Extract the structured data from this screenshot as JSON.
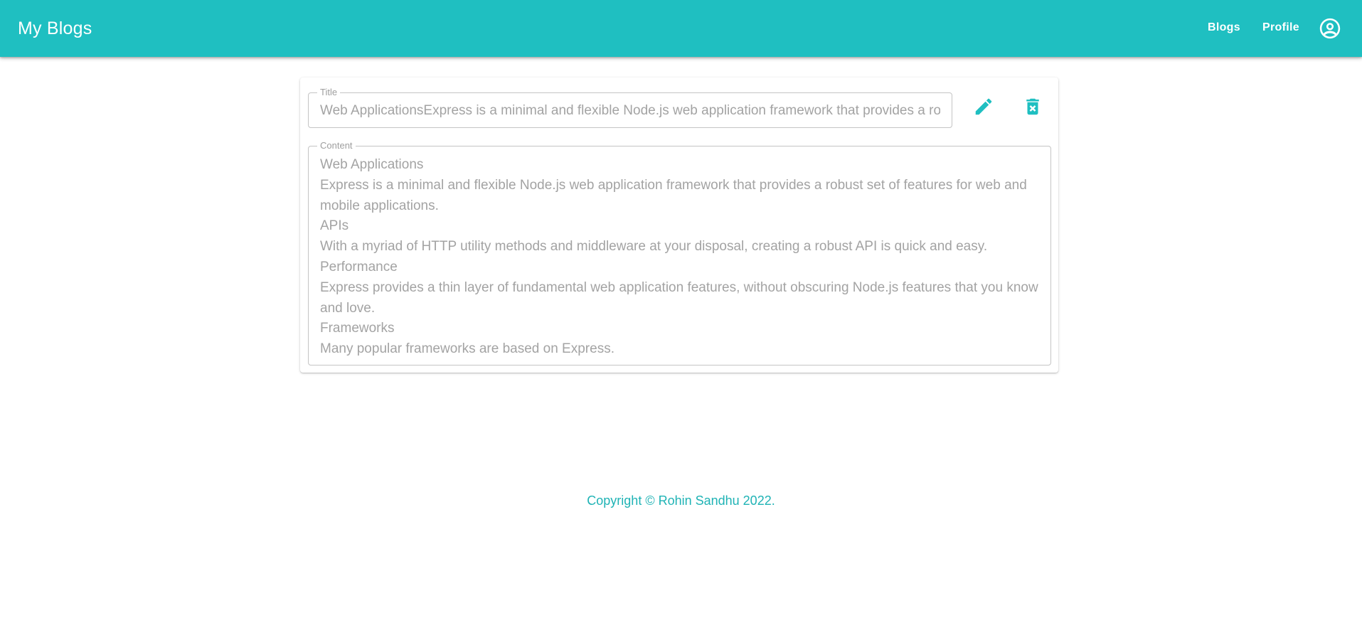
{
  "appbar": {
    "brand": "My Blogs",
    "nav": [
      {
        "label": "Blogs"
      },
      {
        "label": "Profile"
      }
    ],
    "account_icon": "account-circle-icon"
  },
  "blog": {
    "title_label": "Title",
    "title_value": "Web ApplicationsExpress is a minimal and flexible Node.js web application framework that provides a robust set of features for web and mobile applications.",
    "content_label": "Content",
    "content_lines": [
      "Web Applications",
      "Express is a minimal and flexible Node.js web application framework that provides a robust set of features for web and mobile applications.",
      "APIs",
      "With a myriad of HTTP utility methods and middleware at your disposal, creating a robust API is quick and easy.",
      "Performance",
      "Express provides a thin layer of fundamental web application features, without obscuring Node.js features that you know and love.",
      "Frameworks",
      "Many popular frameworks are based on Express."
    ],
    "edit_icon": "pencil-icon",
    "delete_icon": "delete-forever-icon"
  },
  "footer": {
    "copyright": "Copyright © Rohin Sandhu 2022."
  },
  "colors": {
    "primary": "#1fbfc1",
    "text_muted": "#a3a3a3",
    "border": "#c4c4c4"
  }
}
